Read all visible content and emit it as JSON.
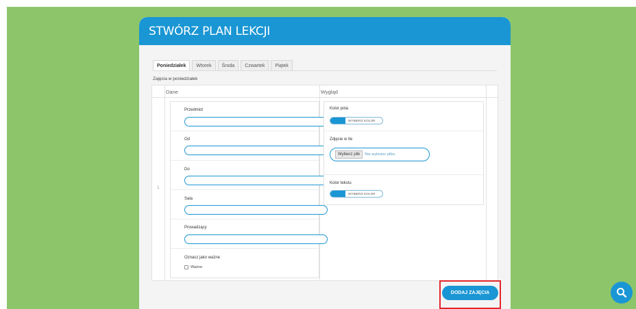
{
  "page": {
    "title": "STWÓRZ PLAN LEKCJI"
  },
  "tabs": [
    {
      "label": "Poniedziałek",
      "active": true
    },
    {
      "label": "Wtorek",
      "active": false
    },
    {
      "label": "Środa",
      "active": false
    },
    {
      "label": "Czwartek",
      "active": false
    },
    {
      "label": "Piątek",
      "active": false
    }
  ],
  "section_title": "Zajęcia w poniedziałek",
  "table": {
    "columns": [
      "Dane",
      "Wygląd"
    ],
    "row_number": "1",
    "dane": {
      "przedmiot_label": "Przedmiot",
      "od_label": "Od",
      "do_label": "Do",
      "sala_label": "Sala",
      "prowadzacy_label": "Prowadzący",
      "wazne_label": "Oznacz jako ważne",
      "wazne_checkbox_label": "Ważne"
    },
    "wyglad": {
      "kolor_pola_label": "Kolor pola",
      "kolor_pola_button": "WYBIERZ KOLOR",
      "zdjecie_label": "Zdjęcie w tle",
      "file_button": "Wybierz plik",
      "file_status": "Nie wybrano pliku",
      "kolor_tekstu_label": "Kolor tekstu",
      "kolor_tekstu_button": "WYBIERZ KOLOR"
    }
  },
  "add_button": "DODAJ ZAJĘCIA",
  "colors": {
    "accent": "#1a96d4",
    "background": "#8cc56a",
    "highlight": "#e3242b"
  },
  "icons": {
    "fab": "search-icon"
  }
}
